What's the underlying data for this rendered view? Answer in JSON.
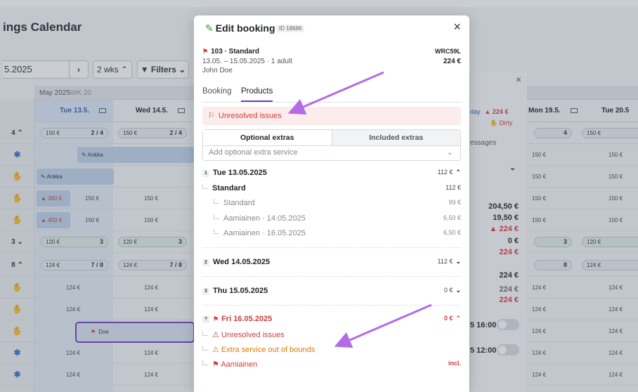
{
  "background": {
    "title": "ings Calendar",
    "date_value": "5.2025",
    "next_label": "›",
    "weeks_label": "2 wks ⌃",
    "filters_label": "▼ Filters ⌄",
    "month_label": "May 2025",
    "week_label": "WK 20",
    "col_tue": "Tue 13.5.",
    "col_wed": "Wed 14.5.",
    "col_mon": "Mon 19.5.",
    "col_tue2": "Tue 20.5",
    "rows": [
      {
        "label": "4 ⌃",
        "tue": "150 €",
        "tue_r": "2 / 4",
        "wed": "150 €",
        "wed_r": "2 / 4",
        "mon": "",
        "mon_r": "4",
        "tue2": "150 €"
      },
      {
        "label": "8 ⌃",
        "tue": "124 €",
        "tue_r": "7 / 8",
        "wed": "124 €",
        "wed_r": "7 / 8",
        "mon": "",
        "mon_r": "8",
        "tue2": "124 €"
      },
      {
        "label": "3 ⌄",
        "tue": "120 €",
        "tue_r": "3",
        "wed": "120 €",
        "wed_r": "3",
        "mon": "",
        "mon_r": "3",
        "tue2": "120 €"
      }
    ],
    "cells": {
      "v150": "150 €",
      "v124": "124 €"
    },
    "chip_ankka": "Ankka",
    "chip_360": "360 €",
    "chip_450": "450 €",
    "doe_label": "Doe",
    "side": {
      "close": "×",
      "day_label": "day",
      "warn_amount": "▲ 224 €",
      "dirty": "Dirty",
      "messages": "essages",
      "a1": "204,50 €",
      "a2": "19,50 €",
      "a3": "▲ 224 €",
      "a4": "0 €",
      "a5": "224 €",
      "a6": "224 €",
      "a7": "224 €",
      "a8": "224 €",
      "t1": "5 16:00",
      "t2": "5 12:00"
    }
  },
  "modal": {
    "title": "Edit booking",
    "id": "ID 18686",
    "close": "×",
    "room": "103 · Standard",
    "dates": "13.05. – 15.05.2025 · 1 adult",
    "guest": "John Doe",
    "code": "WRC59L",
    "price": "224 €",
    "tabs": [
      "Booking",
      "Products"
    ],
    "alert": "Unresolved issues",
    "seg": [
      "Optional extras",
      "Included extras"
    ],
    "add_placeholder": "Add optional extra service",
    "days": [
      {
        "num": "1",
        "label": "Tue 13.05.2025",
        "amount": "112 €",
        "chevron": "⌃"
      },
      {
        "num": "2",
        "label": "Wed 14.05.2025",
        "amount": "112 €",
        "chevron": "⌄"
      },
      {
        "num": "3",
        "label": "Thu 15.05.2025",
        "amount": "0 €",
        "chevron": "⌄"
      },
      {
        "num": "?",
        "label": "Fri 16.05.2025",
        "amount": "0 €",
        "chevron": "⌃"
      }
    ],
    "day1_lines": [
      {
        "label": "Standard",
        "amount": "112 €"
      },
      {
        "label": "Standard",
        "amount": "99 €"
      },
      {
        "label": "Aamiainen · 14.05.2025",
        "amount": "6,50 €"
      },
      {
        "label": "Aamiainen · 16.05.2025",
        "amount": "6,50 €"
      }
    ],
    "day4_lines": [
      {
        "label": "Unresolved issues",
        "amount": ""
      },
      {
        "label": "Extra service out of bounds",
        "amount": ""
      },
      {
        "label": "Aamiainen",
        "amount": "incl."
      }
    ]
  },
  "colors": {
    "accent": "#6c3fbf",
    "danger": "#d23b3b",
    "warning": "#e07a00",
    "arrow": "#b36be6"
  }
}
